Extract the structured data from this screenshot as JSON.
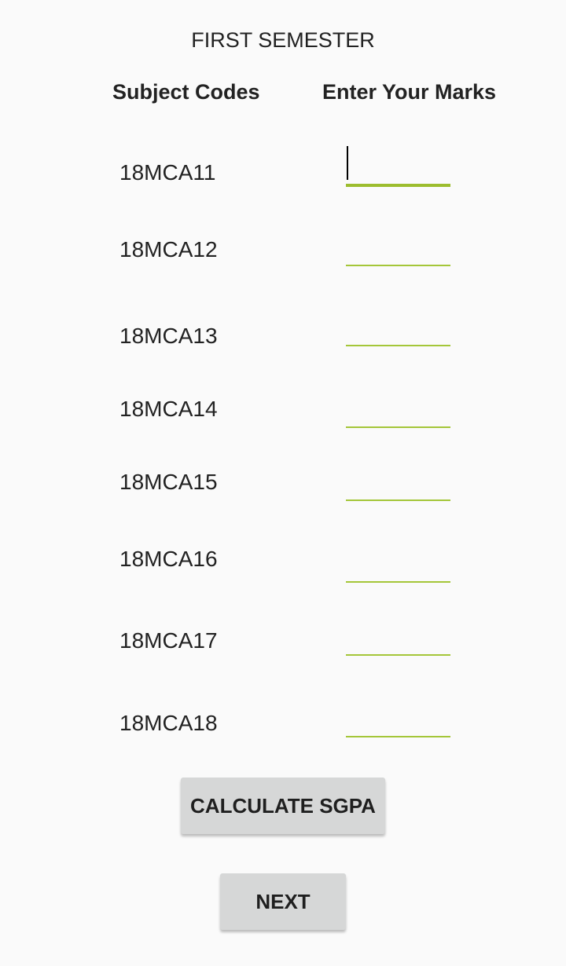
{
  "title": "FIRST SEMESTER",
  "headers": {
    "codes": "Subject Codes",
    "marks": "Enter Your Marks"
  },
  "subjects": [
    {
      "code": "18MCA11",
      "marks": ""
    },
    {
      "code": "18MCA12",
      "marks": ""
    },
    {
      "code": "18MCA13",
      "marks": ""
    },
    {
      "code": "18MCA14",
      "marks": ""
    },
    {
      "code": "18MCA15",
      "marks": ""
    },
    {
      "code": "18MCA16",
      "marks": ""
    },
    {
      "code": "18MCA17",
      "marks": ""
    },
    {
      "code": "18MCA18",
      "marks": ""
    }
  ],
  "buttons": {
    "calculate": "CALCULATE SGPA",
    "next": "NEXT"
  },
  "colors": {
    "accent": "#a4c639",
    "button_bg": "#d6d7d7",
    "background": "#fafafa"
  }
}
